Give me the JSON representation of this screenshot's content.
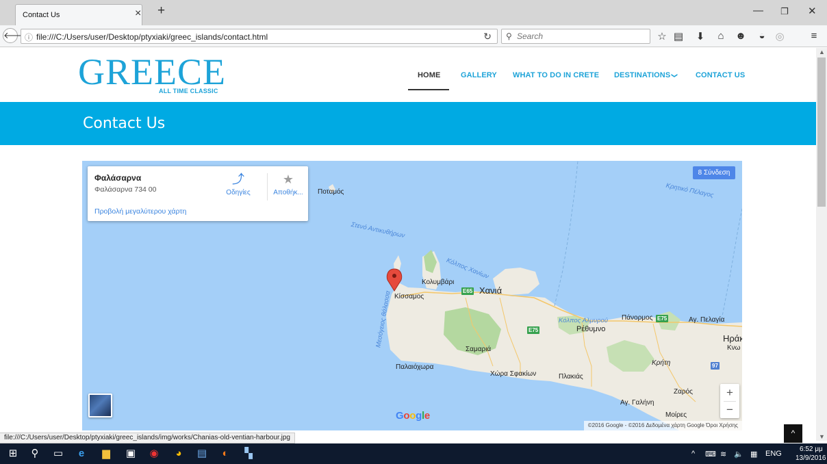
{
  "browser": {
    "tab_title": "Contact Us",
    "tab_close": "×",
    "new_tab": "+",
    "url": "file:///C:/Users/user/Desktop/ptyxiaki/greec_islands/contact.html",
    "search_placeholder": "Search",
    "status_url": "file:///C:/Users/user/Desktop/ptyxiaki/greec_islands/img/works/Chanias-old-ventian-harbour.jpg",
    "toolbar_icons": [
      "star-icon",
      "reading-list-icon",
      "download-icon",
      "home-icon",
      "chat-icon",
      "pocket-icon",
      "extension-icon",
      "menu-icon"
    ]
  },
  "site": {
    "logo_main": "GREECE",
    "logo_sub": "ALL TIME CLASSIC",
    "nav": {
      "home": "HOME",
      "gallery": "GALLERY",
      "what_to_do": "WHAT TO DO IN CRETE",
      "destinations": "DESTINATIONS",
      "destinations_chevron": "❯",
      "contact": "CONTACT US"
    },
    "page_title": "Contact Us",
    "scroll_top_label": "^"
  },
  "map": {
    "place_name": "Φαλάσαρνα",
    "place_address": "Φαλάσαρνα 734 00",
    "larger_map_link": "Προβολή μεγαλύτερου χάρτη",
    "directions_label": "Οδηγίες",
    "save_label": "Αποθήκ...",
    "signin_label": "8 Σύνδεση",
    "zoom_in": "+",
    "zoom_out": "−",
    "copyright": "©2016 Google - ©2016 Δεδομένα χάρτη Google   Όροι Χρήσης",
    "google_logo_letters": [
      "G",
      "o",
      "o",
      "g",
      "l",
      "e"
    ],
    "labels": {
      "potamos": "Ποταμός",
      "kritiko": "Κρητικό Πέλαγος",
      "steno": "Στενό Αντικυθήρων",
      "kolpos_chanion": "Κόλπος Χανίων",
      "kolympari": "Κολυμβάρι",
      "chania": "Χανιά",
      "kissamos": "Κίσσαμος",
      "mesogeios": "Μεσόγειος θάλασσα",
      "kolpos_almyrou": "Κόλπος Αλμυρού",
      "panormos": "Πάνορμος",
      "ag_pelagia": "Αγ. Πελαγία",
      "rethymno": "Ρέθυμνο",
      "irakli": "Ηράκλ",
      "knos": "Κνω",
      "samaria": "Σαμαριά",
      "paleochora": "Παλαιόχωρα",
      "chora_sfakion": "Χώρα Σφακίων",
      "plakias": "Πλακιάς",
      "kriti": "Κρήτη",
      "zaros": "Ζαρός",
      "ag_galini": "Αγ. Γαλήνη",
      "moires": "Μοίρες"
    },
    "road_shields": {
      "e65": "E65",
      "e75a": "E75",
      "e75b": "E75",
      "r97": "97"
    }
  },
  "taskbar": {
    "language": "ENG",
    "time": "6:52 μμ",
    "date": "13/9/2016"
  },
  "colors": {
    "accent": "#00aae3",
    "link": "#3a84df",
    "sea": "#a4cff8",
    "land": "#eeebe2",
    "forest": "#b4d8a0"
  }
}
